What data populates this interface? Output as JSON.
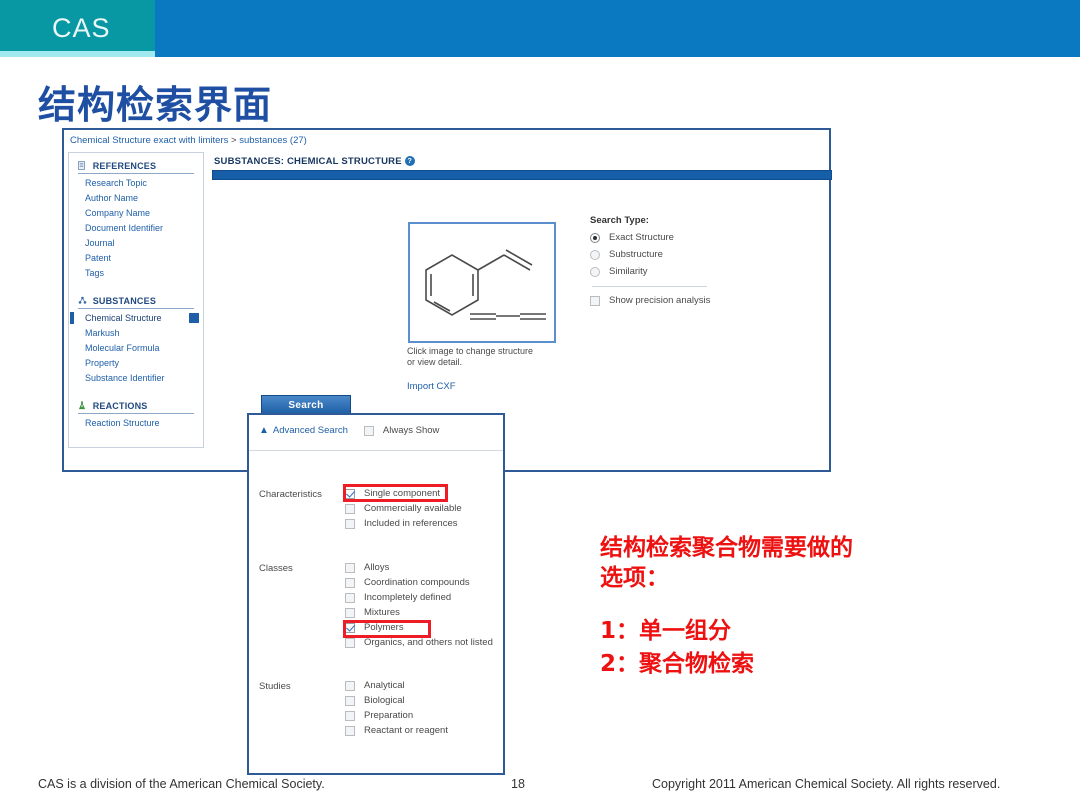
{
  "brand": {
    "name": "CAS"
  },
  "slide": {
    "title": "结构检索界面",
    "page_number": "18"
  },
  "screenshot": {
    "breadcrumb": {
      "first": "Chemical Structure exact with limiters",
      "separator": ">",
      "second": "substances (27)"
    },
    "sidebar": {
      "sections": [
        {
          "title": "REFERENCES",
          "icon": "document-icon",
          "items": [
            {
              "label": "Research Topic",
              "active": false
            },
            {
              "label": "Author Name",
              "active": false
            },
            {
              "label": "Company Name",
              "active": false
            },
            {
              "label": "Document Identifier",
              "active": false
            },
            {
              "label": "Journal",
              "active": false
            },
            {
              "label": "Patent",
              "active": false
            },
            {
              "label": "Tags",
              "active": false
            }
          ]
        },
        {
          "title": "SUBSTANCES",
          "icon": "molecule-icon",
          "items": [
            {
              "label": "Chemical Structure",
              "active": true
            },
            {
              "label": "Markush",
              "active": false
            },
            {
              "label": "Molecular Formula",
              "active": false
            },
            {
              "label": "Property",
              "active": false
            },
            {
              "label": "Substance Identifier",
              "active": false
            }
          ]
        },
        {
          "title": "REACTIONS",
          "icon": "flask-icon",
          "items": [
            {
              "label": "Reaction Structure",
              "active": false
            }
          ]
        }
      ]
    },
    "main": {
      "title": "SUBSTANCES: CHEMICAL STRUCTURE",
      "help_icon": "?",
      "structure_caption_line1": "Click image to change structure",
      "structure_caption_line2": "or view detail.",
      "import_link": "Import CXF",
      "search_type": {
        "heading": "Search Type:",
        "options": [
          {
            "label": "Exact Structure",
            "selected": true
          },
          {
            "label": "Substructure",
            "selected": false
          },
          {
            "label": "Similarity",
            "selected": false
          }
        ],
        "precision": {
          "label": "Show precision analysis",
          "checked": false
        }
      },
      "search_button": "Search"
    },
    "advanced": {
      "toggle_label": "Advanced Search",
      "always_show": {
        "label": "Always Show",
        "checked": false
      },
      "groups": [
        {
          "label": "Characteristics",
          "items": [
            {
              "label": "Single component",
              "checked": true,
              "highlighted": true
            },
            {
              "label": "Commercially available",
              "checked": false,
              "highlighted": false
            },
            {
              "label": "Included in references",
              "checked": false,
              "highlighted": false
            }
          ]
        },
        {
          "label": "Classes",
          "items": [
            {
              "label": "Alloys",
              "checked": false,
              "highlighted": false
            },
            {
              "label": "Coordination compounds",
              "checked": false,
              "highlighted": false
            },
            {
              "label": "Incompletely defined",
              "checked": false,
              "highlighted": false
            },
            {
              "label": "Mixtures",
              "checked": false,
              "highlighted": false
            },
            {
              "label": "Polymers",
              "checked": true,
              "highlighted": true
            },
            {
              "label": "Organics, and others not listed",
              "checked": false,
              "highlighted": false
            }
          ]
        },
        {
          "label": "Studies",
          "items": [
            {
              "label": "Analytical",
              "checked": false,
              "highlighted": false
            },
            {
              "label": "Biological",
              "checked": false,
              "highlighted": false
            },
            {
              "label": "Preparation",
              "checked": false,
              "highlighted": false
            },
            {
              "label": "Reactant or reagent",
              "checked": false,
              "highlighted": false
            }
          ]
        }
      ]
    }
  },
  "annotation": {
    "line1": "结构检索聚合物需要做的",
    "line2": "选项：",
    "item1": "1：单一组分",
    "item2": "2：聚合物检索"
  },
  "footer": {
    "left": "CAS is a division of the American Chemical Society.",
    "page": "18",
    "right": "Copyright 2011 American Chemical Society. All rights reserved."
  },
  "colors": {
    "brand_teal": "#0898a4",
    "brand_blue": "#0b79c2",
    "title_blue": "#1f4fa3",
    "link_blue": "#1f5fa8",
    "highlight_red": "#ee1c24",
    "annotation_red": "#ee1111"
  }
}
